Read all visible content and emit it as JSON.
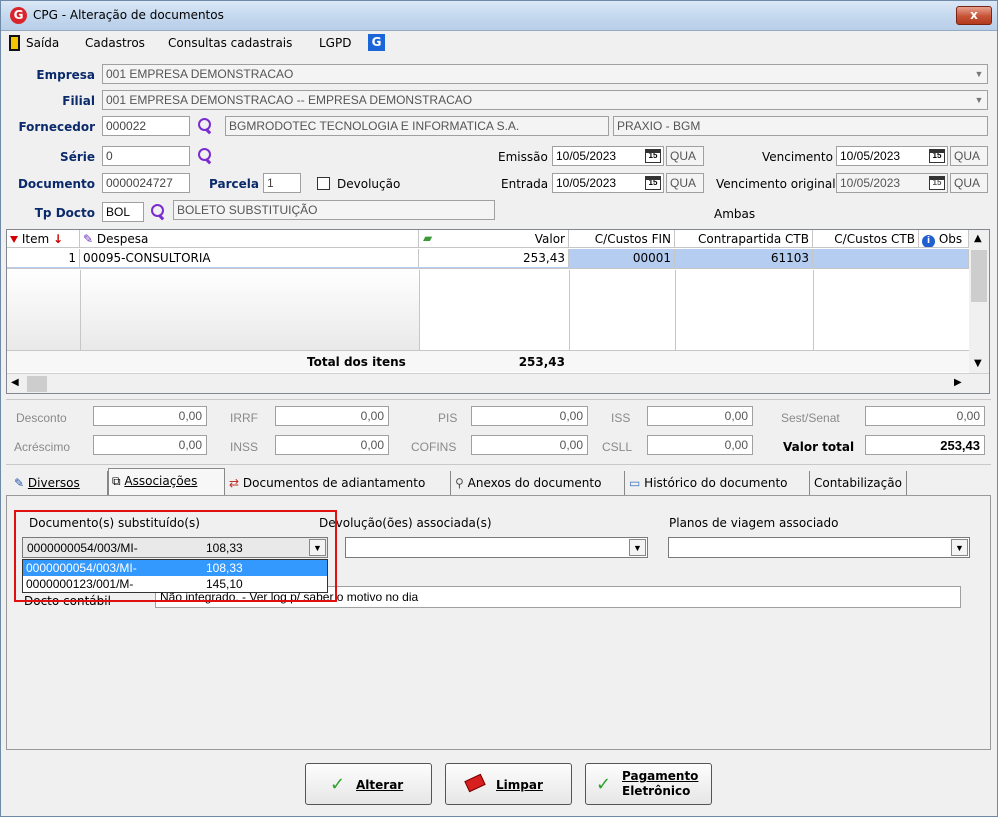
{
  "window": {
    "title": "CPG - Alteração de documentos",
    "app_letter": "G",
    "close_glyph": "x"
  },
  "menu": {
    "items": [
      "Saída",
      "Cadastros",
      "Consultas cadastrais",
      "LGPD"
    ]
  },
  "form": {
    "empresa": {
      "label": "Empresa",
      "value": "001 EMPRESA DEMONSTRACAO"
    },
    "filial": {
      "label": "Filial",
      "value": "001 EMPRESA DEMONSTRACAO -- EMPRESA DEMONSTRACAO"
    },
    "fornecedor": {
      "label": "Fornecedor",
      "code": "000022",
      "name": "BGMRODOTEC TECNOLOGIA E INFORMATICA S.A.",
      "extra": "PRAXIO - BGM"
    },
    "serie": {
      "label": "Série",
      "value": "0"
    },
    "documento": {
      "label": "Documento",
      "value": "0000024727"
    },
    "parcela": {
      "label": "Parcela",
      "value": "1"
    },
    "devolucao": {
      "label": "Devolução"
    },
    "tp_docto": {
      "label": "Tp Docto",
      "code": "BOL",
      "desc": "BOLETO SUBSTITUIÇÃO"
    },
    "emissao": {
      "label": "Emissão",
      "date": "10/05/2023",
      "day": "QUA"
    },
    "entrada": {
      "label": "Entrada",
      "date": "10/05/2023",
      "day": "QUA"
    },
    "vencimento": {
      "label": "Vencimento",
      "date": "10/05/2023",
      "day": "QUA"
    },
    "vencimento_original": {
      "label": "Vencimento original",
      "date": "10/05/2023",
      "day": "QUA"
    },
    "ambas": "Ambas",
    "cal_label": "15"
  },
  "grid": {
    "headers": {
      "item": "Item",
      "despesa": "Despesa",
      "valor": "Valor",
      "cfin": "C/Custos FIN",
      "contra": "Contrapartida CTB",
      "cctb": "C/Custos CTB",
      "obs": "Obs"
    },
    "row": {
      "item": "1",
      "despesa": "00095-CONSULTORIA",
      "valor": "253,43",
      "cfin": "00001",
      "contra": "61103",
      "cctb": ""
    },
    "total_label": "Total dos itens",
    "total_value": "253,43"
  },
  "totals": {
    "desconto": {
      "label": "Desconto",
      "value": "0,00"
    },
    "irrf": {
      "label": "IRRF",
      "value": "0,00"
    },
    "pis": {
      "label": "PIS",
      "value": "0,00"
    },
    "iss": {
      "label": "ISS",
      "value": "0,00"
    },
    "sest": {
      "label": "Sest/Senat",
      "value": "0,00"
    },
    "acrescimo": {
      "label": "Acréscimo",
      "value": "0,00"
    },
    "inss": {
      "label": "INSS",
      "value": "0,00"
    },
    "cofins": {
      "label": "COFINS",
      "value": "0,00"
    },
    "csll": {
      "label": "CSLL",
      "value": "0,00"
    },
    "valor_total": {
      "label": "Valor total",
      "value": "253,43"
    }
  },
  "tabs": [
    "Diversos",
    "Associações",
    "Documentos de adiantamento",
    "Anexos do documento",
    "Histórico do documento",
    "Contabilização"
  ],
  "associacoes": {
    "substituidos": {
      "label": "Documento(s) substituído(s)",
      "selected": {
        "doc": "0000000054/003/MI-",
        "value": "108,33"
      },
      "options": [
        {
          "doc": "0000000054/003/MI-",
          "value": "108,33"
        },
        {
          "doc": "0000000123/001/M-",
          "value": "145,10"
        }
      ]
    },
    "devolucoes": {
      "label": "Devolução(ões) associada(s)",
      "value": ""
    },
    "planos": {
      "label": "Planos de viagem associado",
      "value": ""
    },
    "docto_contabil": {
      "label": "Docto contábil",
      "value": "Não integrado. - Ver log p/ saber o motivo no dia"
    }
  },
  "buttons": {
    "alterar": "Alterar",
    "limpar": "Limpar",
    "pagamento_1": "Pagamento",
    "pagamento_2": "Eletrônico"
  },
  "colors": {
    "accent_purple": "#7a2bd1",
    "selection_blue": "#3399ff",
    "row_highlight": "#b4cdf0",
    "focus_red": "#e01010"
  }
}
